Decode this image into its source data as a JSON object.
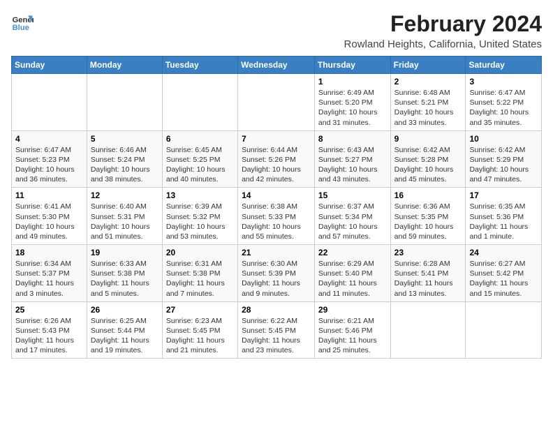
{
  "header": {
    "logo_line1": "General",
    "logo_line2": "Blue",
    "title": "February 2024",
    "subtitle": "Rowland Heights, California, United States"
  },
  "columns": [
    "Sunday",
    "Monday",
    "Tuesday",
    "Wednesday",
    "Thursday",
    "Friday",
    "Saturday"
  ],
  "weeks": [
    [
      {
        "day": "",
        "info": ""
      },
      {
        "day": "",
        "info": ""
      },
      {
        "day": "",
        "info": ""
      },
      {
        "day": "",
        "info": ""
      },
      {
        "day": "1",
        "info": "Sunrise: 6:49 AM\nSunset: 5:20 PM\nDaylight: 10 hours\nand 31 minutes."
      },
      {
        "day": "2",
        "info": "Sunrise: 6:48 AM\nSunset: 5:21 PM\nDaylight: 10 hours\nand 33 minutes."
      },
      {
        "day": "3",
        "info": "Sunrise: 6:47 AM\nSunset: 5:22 PM\nDaylight: 10 hours\nand 35 minutes."
      }
    ],
    [
      {
        "day": "4",
        "info": "Sunrise: 6:47 AM\nSunset: 5:23 PM\nDaylight: 10 hours\nand 36 minutes."
      },
      {
        "day": "5",
        "info": "Sunrise: 6:46 AM\nSunset: 5:24 PM\nDaylight: 10 hours\nand 38 minutes."
      },
      {
        "day": "6",
        "info": "Sunrise: 6:45 AM\nSunset: 5:25 PM\nDaylight: 10 hours\nand 40 minutes."
      },
      {
        "day": "7",
        "info": "Sunrise: 6:44 AM\nSunset: 5:26 PM\nDaylight: 10 hours\nand 42 minutes."
      },
      {
        "day": "8",
        "info": "Sunrise: 6:43 AM\nSunset: 5:27 PM\nDaylight: 10 hours\nand 43 minutes."
      },
      {
        "day": "9",
        "info": "Sunrise: 6:42 AM\nSunset: 5:28 PM\nDaylight: 10 hours\nand 45 minutes."
      },
      {
        "day": "10",
        "info": "Sunrise: 6:42 AM\nSunset: 5:29 PM\nDaylight: 10 hours\nand 47 minutes."
      }
    ],
    [
      {
        "day": "11",
        "info": "Sunrise: 6:41 AM\nSunset: 5:30 PM\nDaylight: 10 hours\nand 49 minutes."
      },
      {
        "day": "12",
        "info": "Sunrise: 6:40 AM\nSunset: 5:31 PM\nDaylight: 10 hours\nand 51 minutes."
      },
      {
        "day": "13",
        "info": "Sunrise: 6:39 AM\nSunset: 5:32 PM\nDaylight: 10 hours\nand 53 minutes."
      },
      {
        "day": "14",
        "info": "Sunrise: 6:38 AM\nSunset: 5:33 PM\nDaylight: 10 hours\nand 55 minutes."
      },
      {
        "day": "15",
        "info": "Sunrise: 6:37 AM\nSunset: 5:34 PM\nDaylight: 10 hours\nand 57 minutes."
      },
      {
        "day": "16",
        "info": "Sunrise: 6:36 AM\nSunset: 5:35 PM\nDaylight: 10 hours\nand 59 minutes."
      },
      {
        "day": "17",
        "info": "Sunrise: 6:35 AM\nSunset: 5:36 PM\nDaylight: 11 hours\nand 1 minute."
      }
    ],
    [
      {
        "day": "18",
        "info": "Sunrise: 6:34 AM\nSunset: 5:37 PM\nDaylight: 11 hours\nand 3 minutes."
      },
      {
        "day": "19",
        "info": "Sunrise: 6:33 AM\nSunset: 5:38 PM\nDaylight: 11 hours\nand 5 minutes."
      },
      {
        "day": "20",
        "info": "Sunrise: 6:31 AM\nSunset: 5:38 PM\nDaylight: 11 hours\nand 7 minutes."
      },
      {
        "day": "21",
        "info": "Sunrise: 6:30 AM\nSunset: 5:39 PM\nDaylight: 11 hours\nand 9 minutes."
      },
      {
        "day": "22",
        "info": "Sunrise: 6:29 AM\nSunset: 5:40 PM\nDaylight: 11 hours\nand 11 minutes."
      },
      {
        "day": "23",
        "info": "Sunrise: 6:28 AM\nSunset: 5:41 PM\nDaylight: 11 hours\nand 13 minutes."
      },
      {
        "day": "24",
        "info": "Sunrise: 6:27 AM\nSunset: 5:42 PM\nDaylight: 11 hours\nand 15 minutes."
      }
    ],
    [
      {
        "day": "25",
        "info": "Sunrise: 6:26 AM\nSunset: 5:43 PM\nDaylight: 11 hours\nand 17 minutes."
      },
      {
        "day": "26",
        "info": "Sunrise: 6:25 AM\nSunset: 5:44 PM\nDaylight: 11 hours\nand 19 minutes."
      },
      {
        "day": "27",
        "info": "Sunrise: 6:23 AM\nSunset: 5:45 PM\nDaylight: 11 hours\nand 21 minutes."
      },
      {
        "day": "28",
        "info": "Sunrise: 6:22 AM\nSunset: 5:45 PM\nDaylight: 11 hours\nand 23 minutes."
      },
      {
        "day": "29",
        "info": "Sunrise: 6:21 AM\nSunset: 5:46 PM\nDaylight: 11 hours\nand 25 minutes."
      },
      {
        "day": "",
        "info": ""
      },
      {
        "day": "",
        "info": ""
      }
    ]
  ]
}
